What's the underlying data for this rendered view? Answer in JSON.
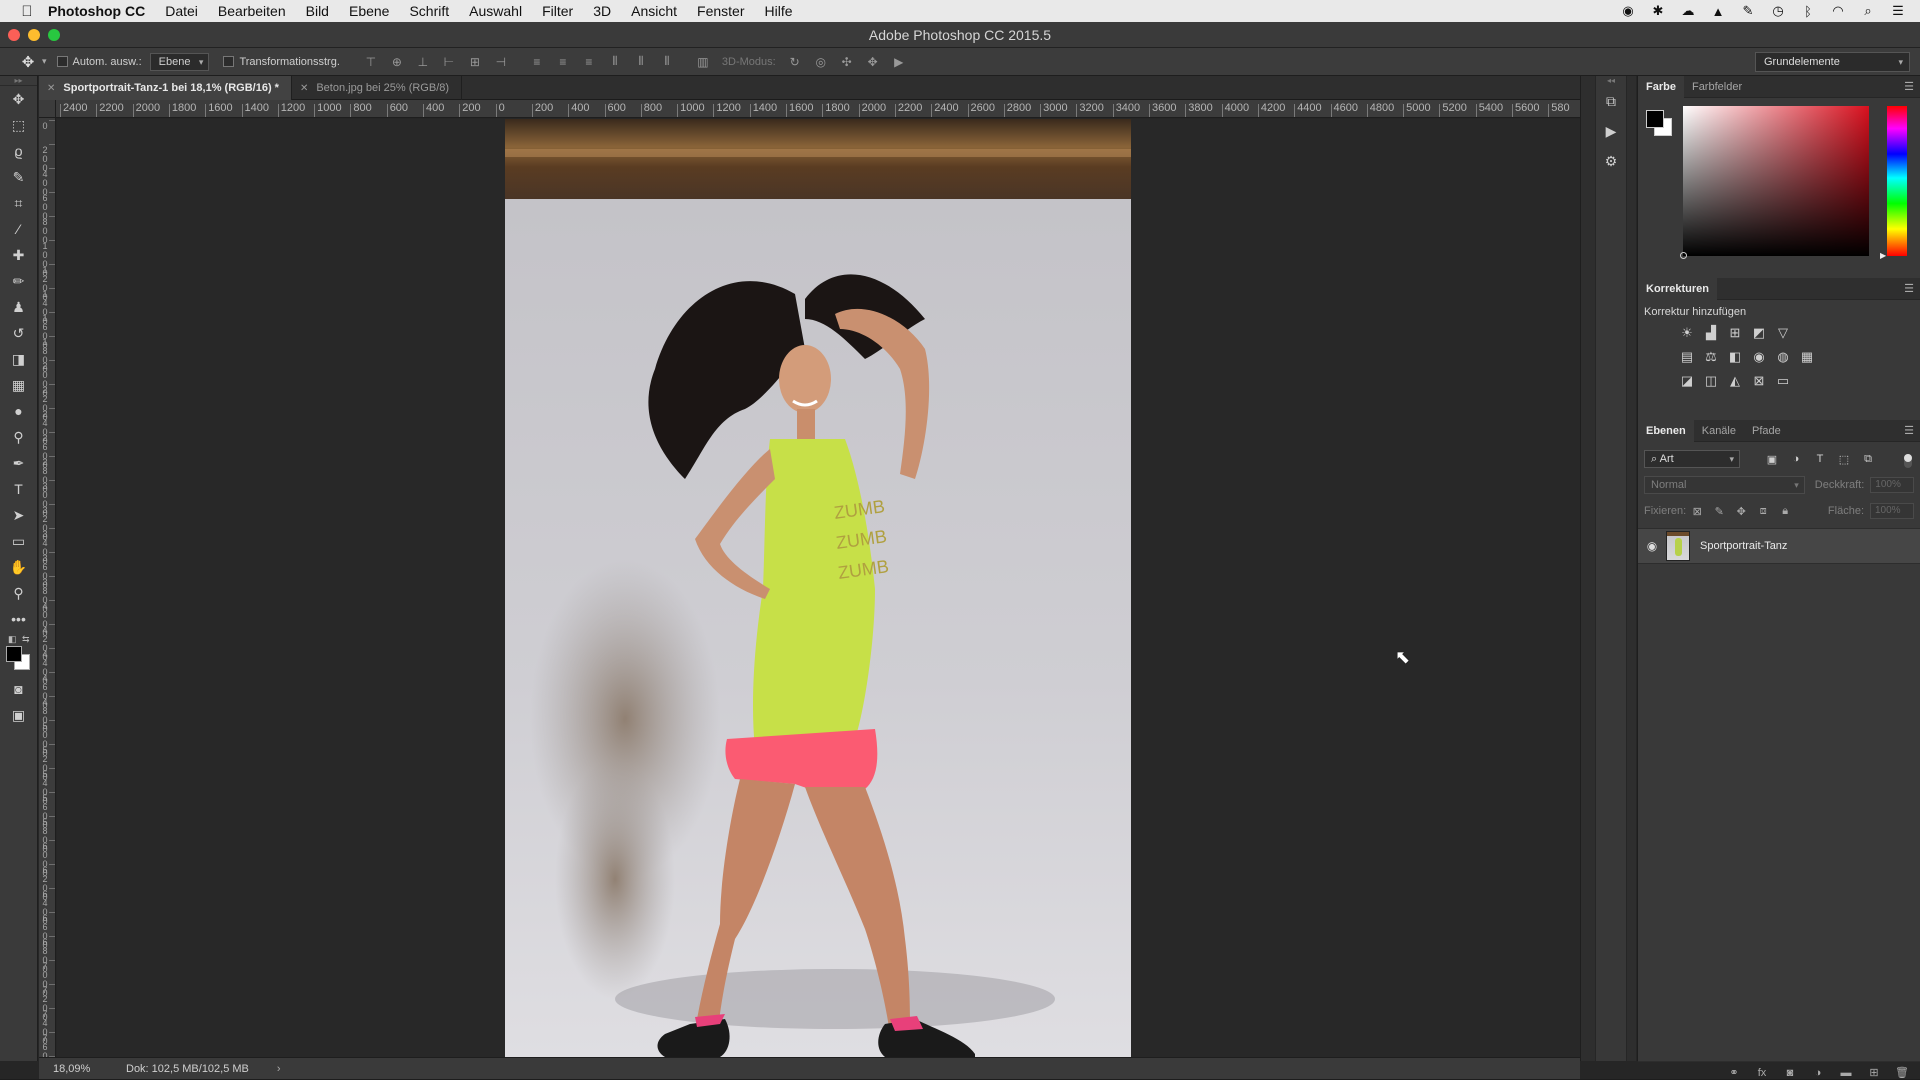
{
  "menubar": {
    "app_name": "Photoshop CC",
    "items": [
      "Datei",
      "Bearbeiten",
      "Bild",
      "Ebene",
      "Schrift",
      "Auswahl",
      "Filter",
      "3D",
      "Ansicht",
      "Fenster",
      "Hilfe"
    ]
  },
  "window": {
    "title": "Adobe Photoshop CC 2015.5"
  },
  "options": {
    "auto_select_label": "Autom. ausw.:",
    "auto_select_value": "Ebene",
    "transform_label": "Transformationsstrg.",
    "mode_label": "3D-Modus:",
    "workspace": "Grundelemente"
  },
  "tabs": [
    {
      "label": "Sportportrait-Tanz-1 bei 18,1% (RGB/16) *",
      "active": true
    },
    {
      "label": "Beton.jpg bei 25% (RGB/8)",
      "active": false
    }
  ],
  "ruler": {
    "h_ticks": [
      "2400",
      "2200",
      "2000",
      "1800",
      "1600",
      "1400",
      "1200",
      "1000",
      "800",
      "600",
      "400",
      "200",
      "0",
      "200",
      "400",
      "600",
      "800",
      "1000",
      "1200",
      "1400",
      "1600",
      "1800",
      "2000",
      "2200",
      "2400",
      "2600",
      "2800",
      "3000",
      "3200",
      "3400",
      "3600",
      "3800",
      "4000",
      "4200",
      "4400",
      "4600",
      "4800",
      "5000",
      "5200",
      "5400",
      "5600",
      "580"
    ],
    "v_ticks": [
      "0",
      "2 0 0",
      "4 0 0",
      "6 0 0",
      "8 0 0",
      "1 0 0 0",
      "1 2 0 0",
      "1 4 0 0",
      "1 6 0 0",
      "1 8 0 0",
      "2 0 0 0",
      "2 2 0 0",
      "2 4 0 0",
      "2 6 0 0",
      "2 8 0 0",
      "3 0 0 0",
      "3 2 0 0",
      "3 4 0 0",
      "3 6 0 0",
      "3 8 0 0",
      "4 0 0 0",
      "4 2 0 0",
      "4 4 0 0",
      "4 6 0 0",
      "4 8 0 0",
      "5 0 0 0",
      "5 2 0 0",
      "5 4 0 0",
      "5 6 0 0",
      "5 8 0 0",
      "6 0 0 0",
      "6 2 0 0",
      "6 4 0 0",
      "6 6 0 0",
      "6 8 0 0",
      "7 0 0 0",
      "7 2 0 0",
      "7 4 0 0",
      "7 6 0 0",
      "7 8 0 0"
    ]
  },
  "status": {
    "zoom": "18,09%",
    "doc": "Dok: 102,5 MB/102,5 MB"
  },
  "panels": {
    "color_tabs": [
      "Farbe",
      "Farbfelder"
    ],
    "corrections_title": "Korrekturen",
    "corrections_subtitle": "Korrektur hinzufügen",
    "layer_tabs": [
      "Ebenen",
      "Kanäle",
      "Pfade"
    ],
    "filter_value": "Art",
    "blend_mode": "Normal",
    "opacity_label": "Deckkraft:",
    "opacity_value": "100%",
    "lock_label": "Fixieren:",
    "fill_label": "Fläche:",
    "fill_value": "100%",
    "layer_name": "Sportportrait-Tanz"
  },
  "colors": {
    "foreground": "#000000",
    "background": "#ffffff",
    "picker_hue": "#d9101e"
  }
}
